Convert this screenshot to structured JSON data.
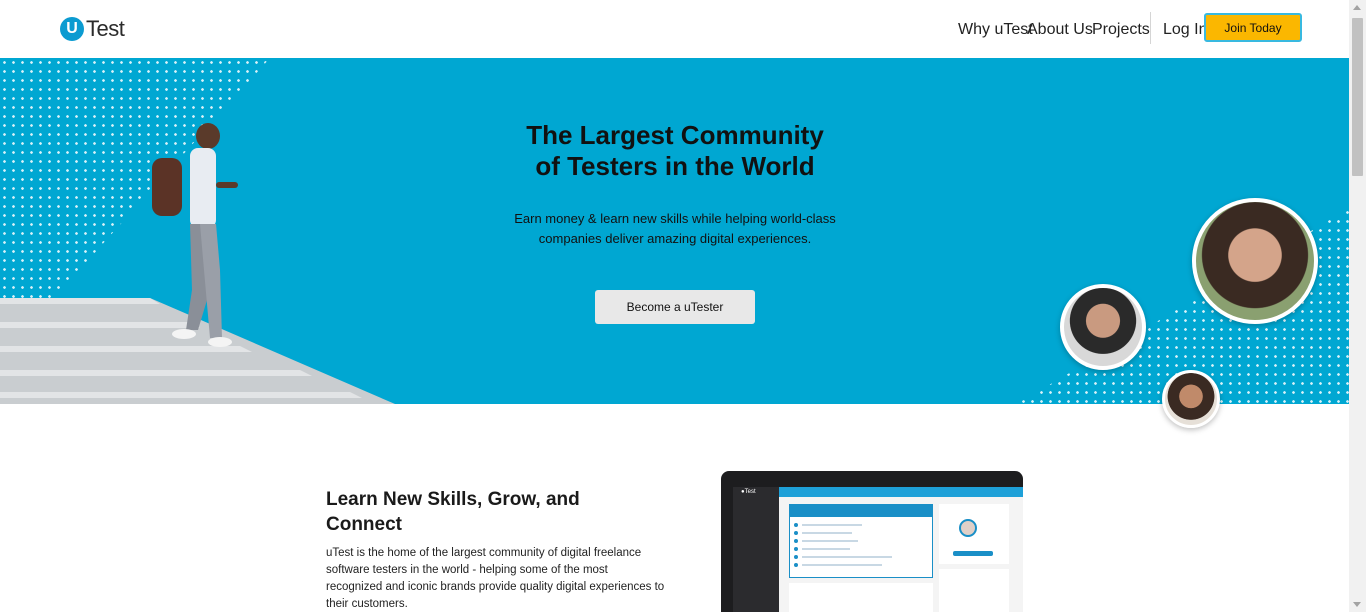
{
  "header": {
    "logo_mark": "U",
    "logo_text": "Test",
    "nav": {
      "why": "Why uTest",
      "about": "About Us",
      "projects": "Projects",
      "login": "Log In",
      "join": "Join Today"
    }
  },
  "hero": {
    "title_line1": "The Largest Community",
    "title_line2": "of Testers in the World",
    "subtitle_line1": "Earn money & learn new skills while helping world-class",
    "subtitle_line2": "companies deliver amazing digital experiences.",
    "cta": "Become a uTester"
  },
  "section": {
    "title": "Learn New Skills, Grow, and Connect",
    "body": "uTest is the home of the largest community of digital freelance software testers in the world - helping some of the most recognized and iconic brands provide quality digital experiences to their customers."
  },
  "colors": {
    "hero_bg": "#00a7d2",
    "join_bg": "#fbb700",
    "brand_blue": "#0b9bd1"
  }
}
